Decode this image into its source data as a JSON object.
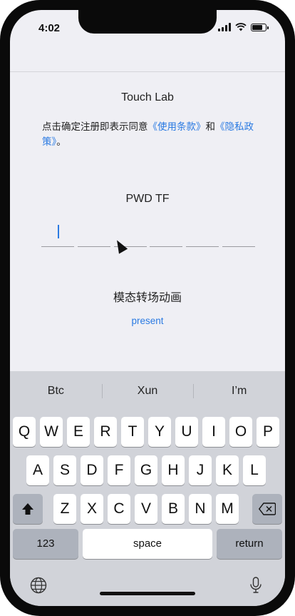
{
  "status_bar": {
    "time": "4:02",
    "battery_level": 0.85
  },
  "content": {
    "title": "Touch Lab",
    "agreement": {
      "prefix": "点击确定注册即表示同意",
      "terms_link": "《使用条款》",
      "and": "和",
      "privacy_link": "《隐私政策》",
      "suffix": "。"
    },
    "pwd_title": "PWD TF",
    "pwd_slot_count": 6,
    "modal_title": "模态转场动画",
    "present_link": "present"
  },
  "keyboard": {
    "suggestions": [
      "Btc",
      "Xun",
      "I’m"
    ],
    "row1": [
      "Q",
      "W",
      "E",
      "R",
      "T",
      "Y",
      "U",
      "I",
      "O",
      "P"
    ],
    "row2": [
      "A",
      "S",
      "D",
      "F",
      "G",
      "H",
      "J",
      "K",
      "L"
    ],
    "row3": [
      "Z",
      "X",
      "C",
      "V",
      "B",
      "N",
      "M"
    ],
    "numbers_key": "123",
    "space_key": "space",
    "return_key": "return"
  },
  "colors": {
    "accent": "#2a7ae2",
    "background": "#efeff4",
    "keyboard_bg": "#d1d3d9"
  }
}
